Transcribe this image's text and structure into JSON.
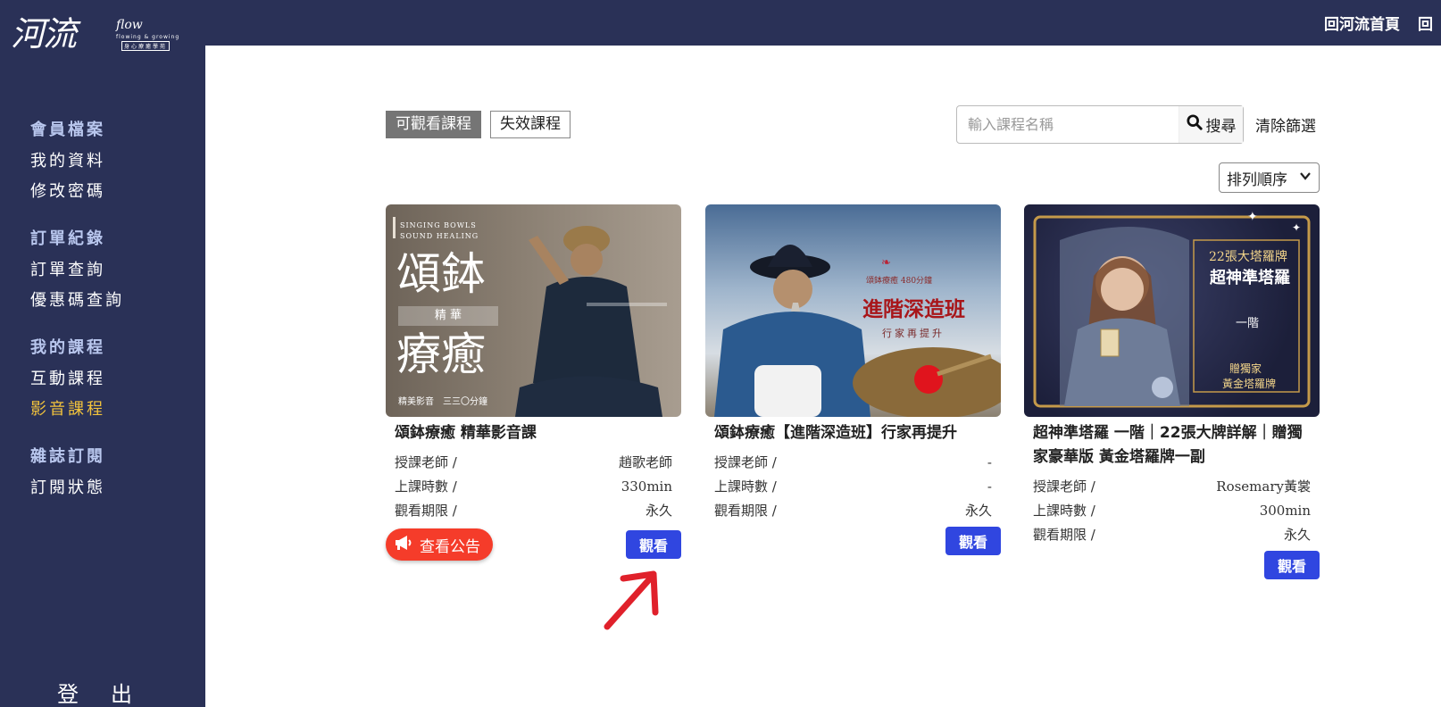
{
  "header": {
    "links": [
      "回河流首頁",
      "回"
    ]
  },
  "logo": {
    "main": "河流",
    "flow": "flow",
    "tagline": "flowing & growing",
    "boxed": "身心療癒學苑"
  },
  "sidebar": {
    "groups": [
      {
        "heading": "會員檔案",
        "items": [
          "我的資料",
          "修改密碼"
        ]
      },
      {
        "heading": "訂單紀錄",
        "items": [
          "訂單查詢",
          "優惠碼查詢"
        ]
      },
      {
        "heading": "我的課程",
        "items": [
          "互動課程",
          "影音課程"
        ]
      },
      {
        "heading": "雜誌訂閱",
        "items": [
          "訂閱狀態"
        ]
      }
    ],
    "active_item": "影音課程",
    "logout": "登出"
  },
  "tabs": {
    "active": "可觀看課程",
    "inactive": "失效課程"
  },
  "search": {
    "placeholder": "輸入課程名稱",
    "button": "搜尋",
    "clear": "清除篩選"
  },
  "sort": {
    "label": "排列順序"
  },
  "courses": [
    {
      "title": "頌鉢療癒 精華影音課",
      "teacher_label": "授課老師 /",
      "teacher": "趙歌老師",
      "duration_label": "上課時數 /",
      "duration": "330min",
      "period_label": "觀看期限 /",
      "period": "永久",
      "watch": "觀看",
      "notice": "查看公告",
      "thumb": {
        "small_en": "SINGING BOWLS\nSOUND HEALING",
        "big1": "頌鉢",
        "badge": "精 華",
        "big2": "療癒",
        "bottom": "精美影音　三三〇分鐘"
      }
    },
    {
      "title": "頌鉢療癒【進階深造班】行家再提升",
      "teacher_label": "授課老師 /",
      "teacher": "-",
      "duration_label": "上課時數 /",
      "duration": "-",
      "period_label": "觀看期限 /",
      "period": "永久",
      "watch": "觀看",
      "thumb": {
        "small": "頌鉢療癒 480分鐘",
        "big": "進階深造班",
        "sub": "行家再提升"
      }
    },
    {
      "title": "超神準塔羅 一階｜22張大牌詳解｜贈獨家豪華版 黃金塔羅牌一副",
      "teacher_label": "授課老師 /",
      "teacher": "Rosemary黃裳",
      "duration_label": "上課時數 /",
      "duration": "300min",
      "period_label": "觀看期限 /",
      "period": "永久",
      "watch": "觀看",
      "thumb": {
        "line1": "22張大塔羅牌",
        "line2": "超神準塔羅",
        "line3": "一階",
        "line4": "贈獨家",
        "line5": "黃金塔羅牌"
      }
    }
  ],
  "colors": {
    "sidebar": "#2a3157",
    "accent": "#3046e0",
    "active_nav": "#f1c23c",
    "notice": "#f53c2a"
  }
}
